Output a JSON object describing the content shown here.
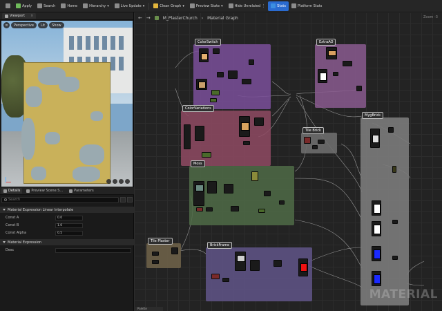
{
  "toolbar": {
    "items": [
      {
        "label": "Save",
        "icon": "save-icon"
      },
      {
        "label": "Apply",
        "icon": "apply-icon"
      },
      {
        "label": "Search",
        "icon": "search-icon"
      },
      {
        "label": "Home",
        "icon": "home-icon"
      },
      {
        "label": "Hierarchy",
        "icon": "hierarchy-icon"
      },
      {
        "label": "Live Update",
        "icon": "live-update-icon"
      },
      {
        "label": "Clean Graph",
        "icon": "clean-graph-icon"
      },
      {
        "label": "Preview State",
        "icon": "preview-state-icon"
      },
      {
        "label": "Hide Unrelated",
        "icon": "hide-unrelated-icon"
      },
      {
        "label": "Stats",
        "icon": "stats-icon"
      },
      {
        "label": "Platform Stats",
        "icon": "platform-stats-icon"
      }
    ]
  },
  "viewport": {
    "tab_label": "Viewport",
    "perspective_label": "Perspective",
    "lit_label": "Lit",
    "show_label": "Show"
  },
  "details": {
    "tabs": [
      "Details",
      "Preview Scene S...",
      "Parameters"
    ],
    "search_placeholder": "Search",
    "section_lerp": "Material Expression Linear Interpolate",
    "props": [
      {
        "label": "Const A",
        "value": "0.0"
      },
      {
        "label": "Const B",
        "value": "1.0"
      },
      {
        "label": "Const Alpha",
        "value": "0.5"
      }
    ],
    "section_expr": "Material Expression",
    "desc_label": "Desc"
  },
  "graph": {
    "breadcrumb_material": "M_PlasterChurch",
    "breadcrumb_graph": "Material Graph",
    "zoom_label": "Zoom -3",
    "watermark": "MATERIAL",
    "bottom_tab": "Palette"
  },
  "comments": [
    {
      "id": "colorswitch",
      "title": "ColorSwitch",
      "color": "#7a4f9a"
    },
    {
      "id": "extraao",
      "title": "ExtraAO",
      "color": "#8a5a8f"
    },
    {
      "id": "colorvariations",
      "title": "ColorVariations",
      "color": "#8f4a63"
    },
    {
      "id": "tilebrick",
      "title": "Tile Brick",
      "color": "#6d6d6d"
    },
    {
      "id": "mygbrick",
      "title": "MygBrick",
      "color": "#7b7b7b"
    },
    {
      "id": "moss",
      "title": "Moss",
      "color": "#4f6b46"
    },
    {
      "id": "tileplaster",
      "title": "Tile Plaster",
      "color": "#6d6048"
    },
    {
      "id": "brickframe",
      "title": "BrickFrame",
      "color": "#5f5385"
    }
  ],
  "colors": {
    "accent_blue": "#2a6bd0",
    "graph_bg": "#232323",
    "panel_bg": "#1a1a1a"
  }
}
